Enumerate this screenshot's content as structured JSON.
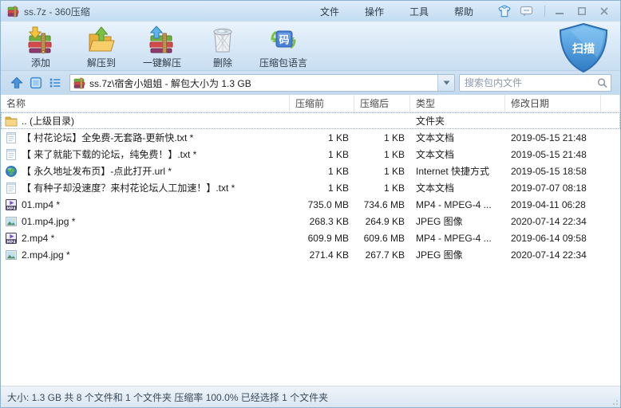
{
  "window": {
    "title": "ss.7z - 360压缩",
    "app_icon": "archive-icon",
    "controls": {
      "minimize": "最小化",
      "maximize": "最大化",
      "close": "关闭"
    }
  },
  "menu": {
    "items": [
      {
        "label": "文件"
      },
      {
        "label": "操作"
      },
      {
        "label": "工具"
      },
      {
        "label": "帮助"
      }
    ],
    "icons": [
      "skin-icon",
      "feedback-icon"
    ]
  },
  "toolbar": {
    "buttons": [
      {
        "label": "添加",
        "icon": "add-archive-icon"
      },
      {
        "label": "解压到",
        "icon": "extract-to-icon"
      },
      {
        "label": "一键解压",
        "icon": "one-click-extract-icon"
      },
      {
        "label": "删除",
        "icon": "delete-trash-icon"
      },
      {
        "label": "压缩包语言",
        "icon": "archive-language-icon"
      }
    ],
    "scan": {
      "label": "扫描",
      "icon": "shield-icon"
    }
  },
  "addressbar": {
    "nav_icons": [
      "up-icon",
      "view-mode-icon",
      "list-mode-icon"
    ],
    "path": "ss.7z\\宿舍小姐姐 - 解包大小为 1.3 GB",
    "search_placeholder": "搜索包内文件",
    "search_icon": "magnifier-icon"
  },
  "list": {
    "columns": [
      "名称",
      "压缩前",
      "压缩后",
      "类型",
      "修改日期"
    ],
    "rows": [
      {
        "icon": "folder-icon",
        "name": ".. (上级目录)",
        "size_before": "",
        "size_after": "",
        "type": "文件夹",
        "date": ""
      },
      {
        "icon": "text-file-icon",
        "name": "【 村花论坛】全免费-无套路-更新快.txt *",
        "size_before": "1 KB",
        "size_after": "1 KB",
        "type": "文本文档",
        "date": "2019-05-15 21:48"
      },
      {
        "icon": "text-file-icon",
        "name": "【 来了就能下载的论坛，纯免费！】.txt *",
        "size_before": "1 KB",
        "size_after": "1 KB",
        "type": "文本文档",
        "date": "2019-05-15 21:48"
      },
      {
        "icon": "globe-icon",
        "name": "【 永久地址发布页】-点此打开.url *",
        "size_before": "1 KB",
        "size_after": "1 KB",
        "type": "Internet 快捷方式",
        "date": "2019-05-15 18:58"
      },
      {
        "icon": "text-file-icon",
        "name": "【 有种子却没速度？来村花论坛人工加速！】.txt *",
        "size_before": "1 KB",
        "size_after": "1 KB",
        "type": "文本文档",
        "date": "2019-07-07 08:18"
      },
      {
        "icon": "mp4-file-icon",
        "name": "01.mp4 *",
        "size_before": "735.0 MB",
        "size_after": "734.6 MB",
        "type": "MP4 - MPEG-4 ...",
        "date": "2019-04-11 06:28"
      },
      {
        "icon": "jpeg-file-icon",
        "name": "01.mp4.jpg *",
        "size_before": "268.3 KB",
        "size_after": "264.9 KB",
        "type": "JPEG 图像",
        "date": "2020-07-14 22:34"
      },
      {
        "icon": "mp4-file-icon",
        "name": "2.mp4 *",
        "size_before": "609.9 MB",
        "size_after": "609.6 MB",
        "type": "MP4 - MPEG-4 ...",
        "date": "2019-06-14 09:58"
      },
      {
        "icon": "jpeg-file-icon",
        "name": "2.mp4.jpg *",
        "size_before": "271.4 KB",
        "size_after": "267.7 KB",
        "type": "JPEG 图像",
        "date": "2020-07-14 22:34"
      }
    ]
  },
  "statusbar": {
    "text": "大小: 1.3 GB 共 8 个文件和 1 个文件夹 压缩率 100.0% 已经选择 1 个文件夹"
  }
}
